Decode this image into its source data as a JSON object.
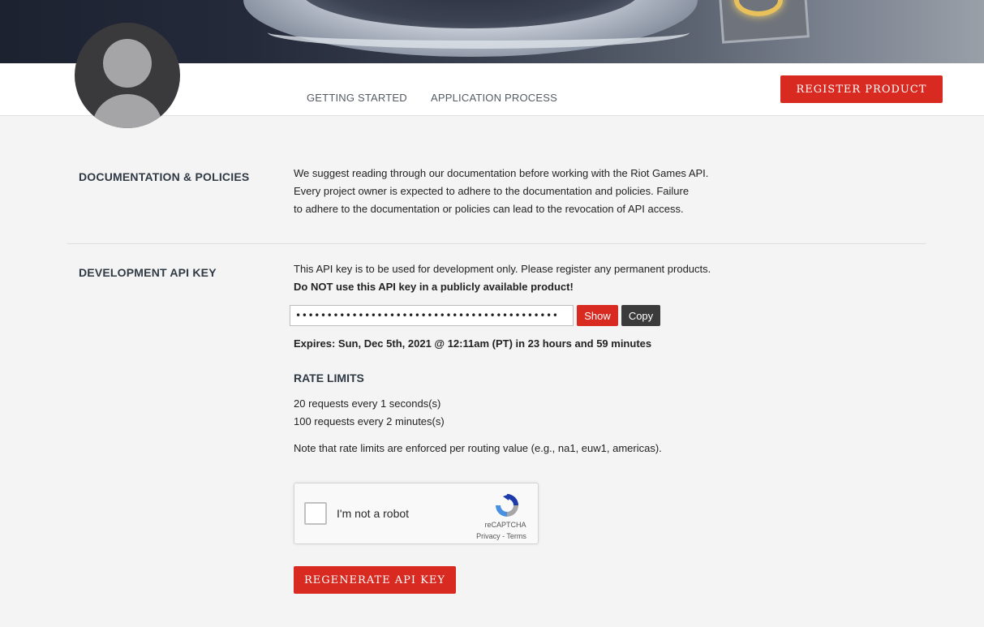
{
  "colors": {
    "accent": "#d92a22",
    "dark_button": "#3b3b3b",
    "heading": "#2f3a45",
    "background": "#f4f4f4"
  },
  "nav": {
    "getting_started": "GETTING STARTED",
    "application_process": "APPLICATION PROCESS",
    "register_product": "REGISTER PRODUCT"
  },
  "docs": {
    "title": "DOCUMENTATION & POLICIES",
    "lines": [
      "We suggest reading through our documentation before working with the Riot Games API.",
      "Every project owner is expected to adhere to the documentation and policies. Failure",
      "to adhere to the documentation or policies can lead to the revocation of API access."
    ]
  },
  "dev_key": {
    "title": "DEVELOPMENT API KEY",
    "note": "This API key is to be used for development only. Please register any permanent products.",
    "warning": "Do NOT use this API key in a publicly available product!",
    "masked_key": "••••••••••••••••••••••••••••••••••••••••••",
    "show_label": "Show",
    "copy_label": "Copy",
    "expires": "Expires: Sun, Dec 5th, 2021 @ 12:11am (PT) in 23 hours and 59 minutes"
  },
  "rate_limits": {
    "title": "RATE LIMITS",
    "items": [
      "20 requests every 1 seconds(s)",
      "100 requests every 2 minutes(s)"
    ],
    "note": "Note that rate limits are enforced per routing value (e.g., na1, euw1, americas)."
  },
  "recaptcha": {
    "label": "I'm not a robot",
    "brand": "reCAPTCHA",
    "links": "Privacy - Terms"
  },
  "regenerate_label": "REGENERATE API KEY"
}
